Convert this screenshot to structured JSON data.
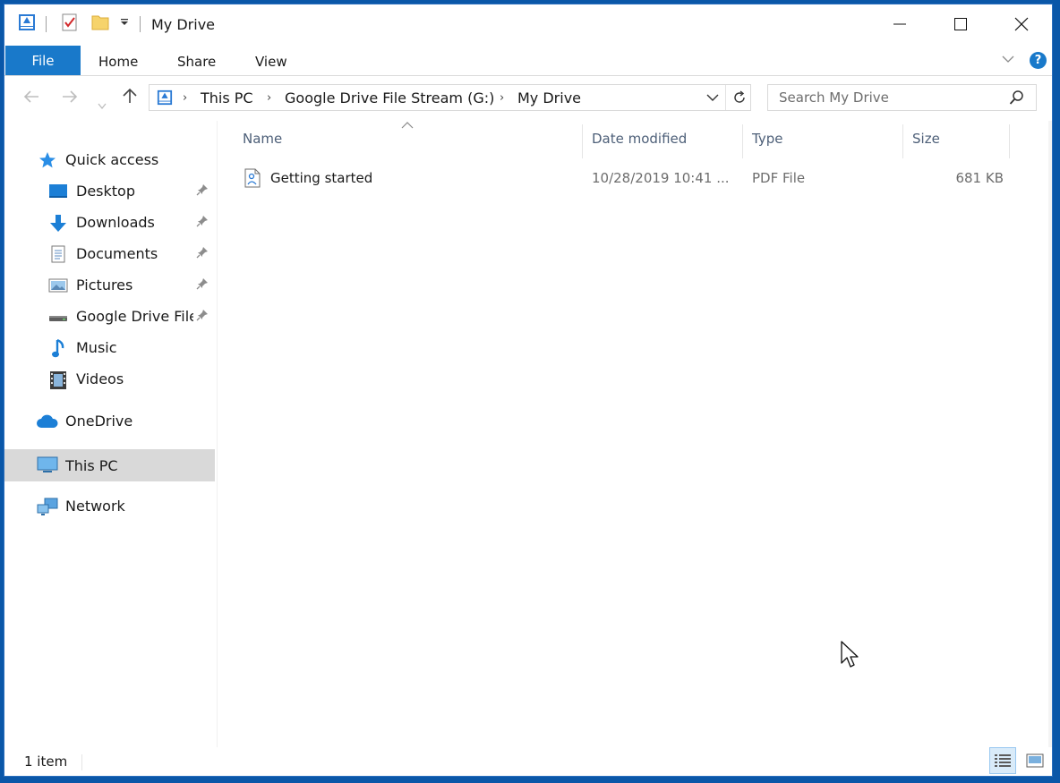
{
  "window": {
    "title": "My Drive",
    "controls": {
      "minimize_icon": "minimize-icon",
      "maximize_icon": "maximize-icon",
      "close_icon": "close-icon"
    }
  },
  "ribbon": {
    "tabs": [
      {
        "label": "File"
      },
      {
        "label": "Home"
      },
      {
        "label": "Share"
      },
      {
        "label": "View"
      }
    ],
    "help_label": "?"
  },
  "address": {
    "crumbs": [
      "This PC",
      "Google Drive File Stream (G:)",
      "My Drive"
    ]
  },
  "search": {
    "placeholder": "Search My Drive"
  },
  "nav": {
    "quick_access": "Quick access",
    "items": [
      {
        "label": "Desktop"
      },
      {
        "label": "Downloads"
      },
      {
        "label": "Documents"
      },
      {
        "label": "Pictures"
      },
      {
        "label": "Google Drive File Stream (G:)"
      },
      {
        "label": "Music"
      },
      {
        "label": "Videos"
      }
    ],
    "onedrive": "OneDrive",
    "this_pc": "This PC",
    "network": "Network"
  },
  "columns": {
    "name": "Name",
    "date_modified": "Date modified",
    "type": "Type",
    "size": "Size"
  },
  "files": [
    {
      "name": "Getting started",
      "date": "10/28/2019 10:41 ...",
      "type": "PDF File",
      "size": "681 KB"
    }
  ],
  "status": {
    "count": "1 item"
  },
  "colors": {
    "accent": "#1979ca",
    "selected": "#d9d9d9",
    "header_text": "#4d5f78"
  }
}
